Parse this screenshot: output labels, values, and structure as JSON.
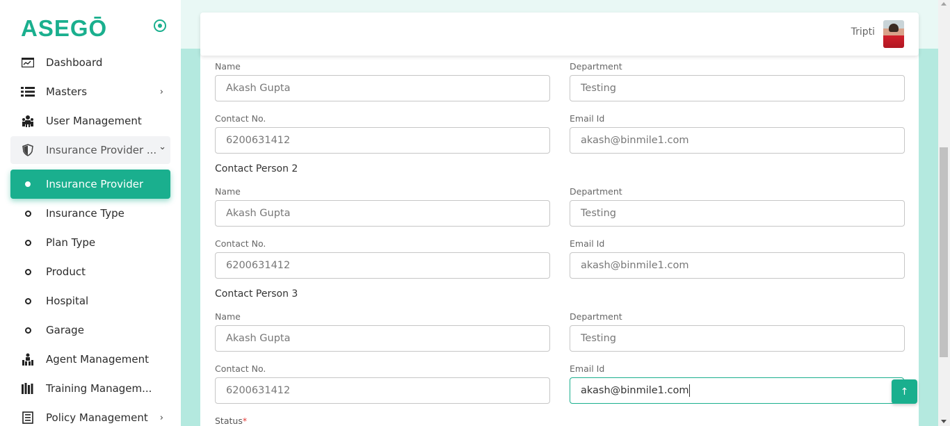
{
  "brand": {
    "name": "ASEGŌ",
    "accent_color": "#1aaf8e"
  },
  "sidebar": {
    "items": [
      {
        "label": "Dashboard",
        "icon": "dashboard-icon"
      },
      {
        "label": "Masters",
        "icon": "list-icon",
        "chevron": "›"
      },
      {
        "label": "User Management",
        "icon": "users-icon"
      },
      {
        "label": "Insurance Provider ...",
        "icon": "shield-icon",
        "chevron": "⌄"
      },
      {
        "label": "Insurance Provider",
        "icon": "dot-icon",
        "active": true
      },
      {
        "label": "Insurance Type",
        "icon": "dot-icon"
      },
      {
        "label": "Plan Type",
        "icon": "dot-icon"
      },
      {
        "label": "Product",
        "icon": "dot-icon"
      },
      {
        "label": "Hospital",
        "icon": "dot-icon"
      },
      {
        "label": "Garage",
        "icon": "dot-icon"
      },
      {
        "label": "Agent Management",
        "icon": "agent-icon"
      },
      {
        "label": "Training Managem...",
        "icon": "books-icon"
      },
      {
        "label": "Policy Management",
        "icon": "policy-icon",
        "chevron": "›"
      }
    ]
  },
  "header": {
    "user_name": "Tripti"
  },
  "form": {
    "labels": {
      "name": "Name",
      "department": "Department",
      "contact": "Contact No.",
      "email": "Email Id",
      "status": "Status",
      "required": "*"
    },
    "contact_person_1": {
      "name": "Akash Gupta",
      "department": "Testing",
      "contact": "6200631412",
      "email": "akash@binmile1.com"
    },
    "contact_person_2": {
      "title": "Contact Person 2",
      "name": "Akash Gupta",
      "department": "Testing",
      "contact": "6200631412",
      "email": "akash@binmile1.com"
    },
    "contact_person_3": {
      "title": "Contact Person 3",
      "name": "Akash Gupta",
      "department": "Testing",
      "contact": "6200631412",
      "email": "akash@binmile1.com"
    }
  },
  "scroll_top_button": {
    "icon": "arrow-up-icon",
    "glyph": "↑"
  }
}
